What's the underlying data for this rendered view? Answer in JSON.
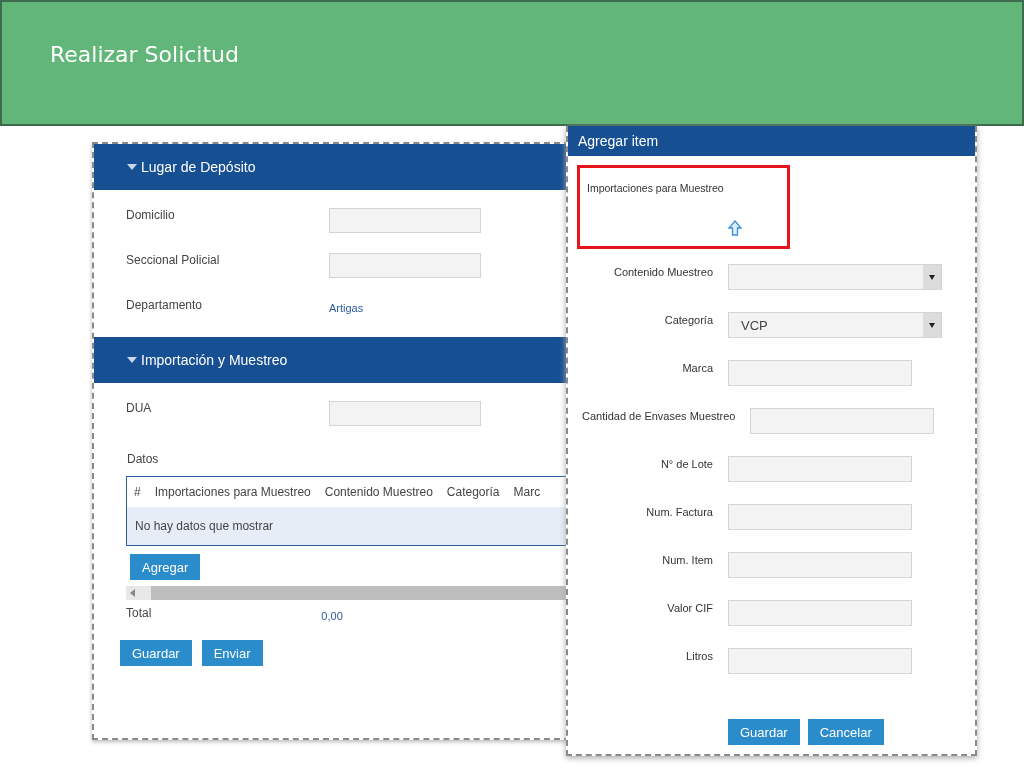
{
  "slide": {
    "title": "Realizar Solicitud"
  },
  "form": {
    "sections": [
      {
        "title": "Lugar de Depósito",
        "expanded": true,
        "fields": [
          {
            "kind": "input",
            "label": "Domicilio"
          },
          {
            "kind": "input",
            "label": "Seccional Policial"
          },
          {
            "kind": "link",
            "label": "Departamento",
            "value": "Artigas"
          }
        ]
      },
      {
        "title": "Importación y Muestreo",
        "expanded": true,
        "fields": [
          {
            "kind": "input",
            "label": "DUA"
          }
        ]
      }
    ],
    "table_label": "Datos",
    "table": {
      "columns": [
        "#",
        "Importaciones para Muestreo",
        "Contenido Muestreo",
        "Categoría",
        "Marc"
      ],
      "empty_message": "No hay datos que mostrar"
    },
    "add_button": "Agregar",
    "total": {
      "label": "Total",
      "value": "0,00"
    },
    "buttons": [
      "Guardar",
      "Enviar"
    ]
  },
  "dialog": {
    "title": "Agregar item",
    "upload": {
      "label": "Importaciones para Muestreo",
      "highlighted": true
    },
    "fields": [
      {
        "kind": "select",
        "label": "Contenido Muestreo"
      },
      {
        "kind": "select",
        "label": "Categoría",
        "value": "VCP"
      },
      {
        "kind": "input",
        "label": "Marca"
      },
      {
        "kind": "input",
        "label": "Cantidad de Envases Muestreo"
      },
      {
        "kind": "input",
        "label": "N° de Lote"
      },
      {
        "kind": "input",
        "label": "Num. Factura"
      },
      {
        "kind": "input",
        "label": "Num. Item"
      },
      {
        "kind": "input",
        "label": "Valor CIF"
      },
      {
        "kind": "input",
        "label": "Litros"
      }
    ],
    "buttons": [
      "Guardar",
      "Cancelar"
    ]
  }
}
